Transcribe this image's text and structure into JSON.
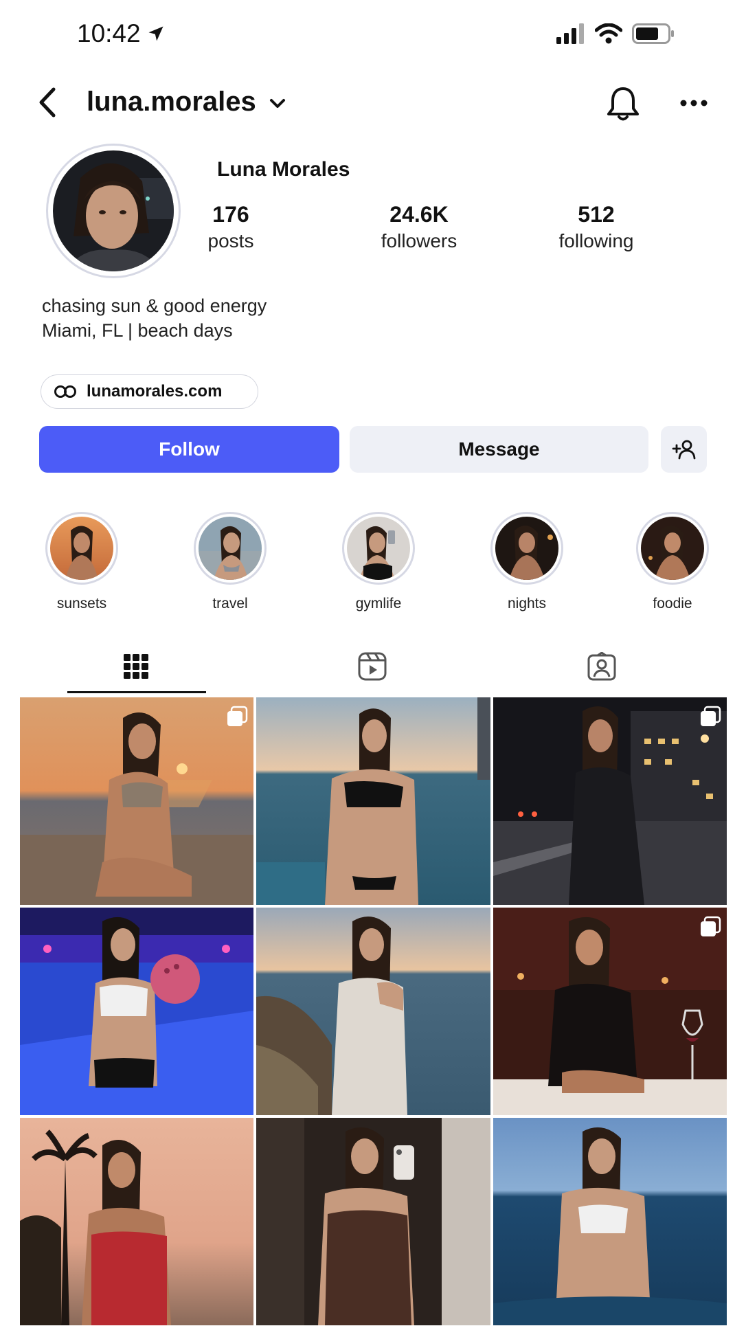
{
  "status_bar": {
    "time": "10:42"
  },
  "header": {
    "username": "luna.morales"
  },
  "profile": {
    "display_name": "Luna Morales",
    "stats": [
      {
        "value": "176",
        "label": "posts"
      },
      {
        "value": "24.6K",
        "label": "followers"
      },
      {
        "value": "512",
        "label": "following"
      }
    ],
    "bio": [
      "chasing sun & good energy",
      "Miami, FL | beach days"
    ],
    "link": "lunamorales.com"
  },
  "actions": {
    "follow": "Follow",
    "message": "Message"
  },
  "highlights": [
    {
      "label": "sunsets"
    },
    {
      "label": "travel"
    },
    {
      "label": "gymlife"
    },
    {
      "label": "nights"
    },
    {
      "label": "foodie"
    }
  ],
  "tabs": [
    "posts-grid",
    "reels",
    "tagged"
  ],
  "colors": {
    "accent": "#4c5cf7",
    "secondary_button": "#eef0f6"
  }
}
